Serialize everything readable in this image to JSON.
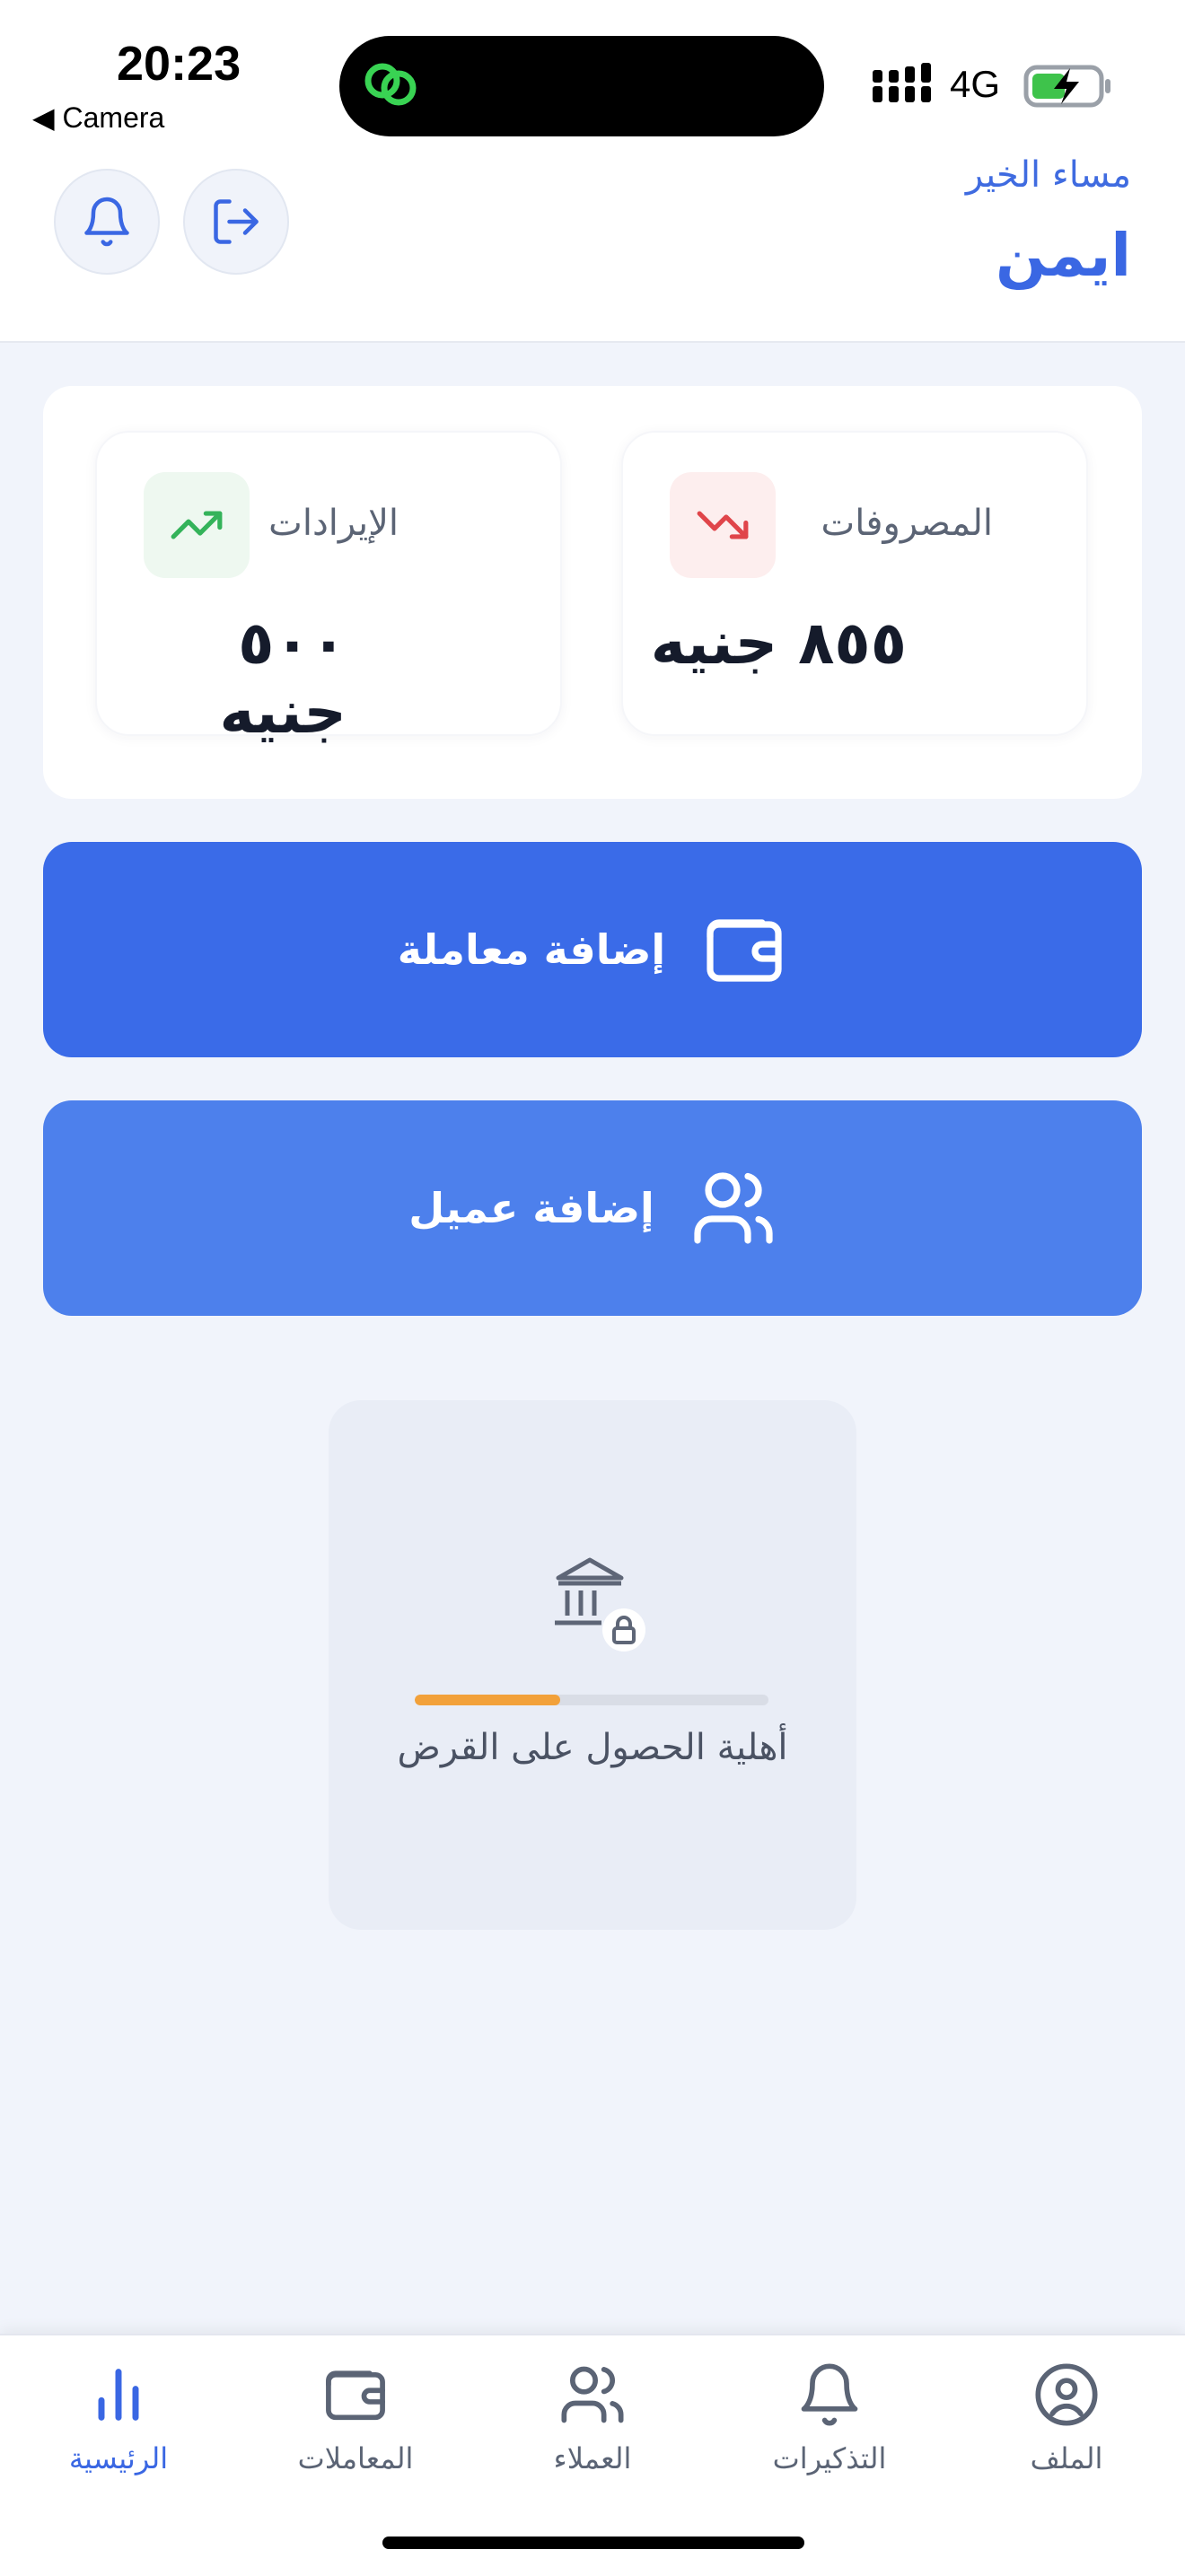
{
  "status_bar": {
    "time": "20:23",
    "back_label": "◀ Camera",
    "network": "4G"
  },
  "header": {
    "greeting": "مساء الخير",
    "username": "ايمن"
  },
  "stats": {
    "expenses": {
      "label": "المصروفات",
      "value": "٨٥٥ جنيه",
      "color": "#e0454a"
    },
    "income": {
      "label": "الإيرادات",
      "value": "٥٠٠ جنيه",
      "color": "#34b35a"
    }
  },
  "actions": {
    "add_transaction": "إضافة معاملة",
    "add_client": "إضافة عميل"
  },
  "loan": {
    "label": "أهلية الحصول على القرض",
    "progress": 0.41
  },
  "bottom_nav": {
    "items": [
      {
        "label": "الملف",
        "icon": "profile-icon"
      },
      {
        "label": "التذكيرات",
        "icon": "bell-icon"
      },
      {
        "label": "العملاء",
        "icon": "users-icon"
      },
      {
        "label": "المعاملات",
        "icon": "wallet-icon"
      },
      {
        "label": "الرئيسية",
        "icon": "chart-icon",
        "active": true
      }
    ]
  },
  "colors": {
    "primary": "#3a6be8",
    "primary_light": "#4d80ec",
    "accent_orange": "#f2a13a"
  }
}
